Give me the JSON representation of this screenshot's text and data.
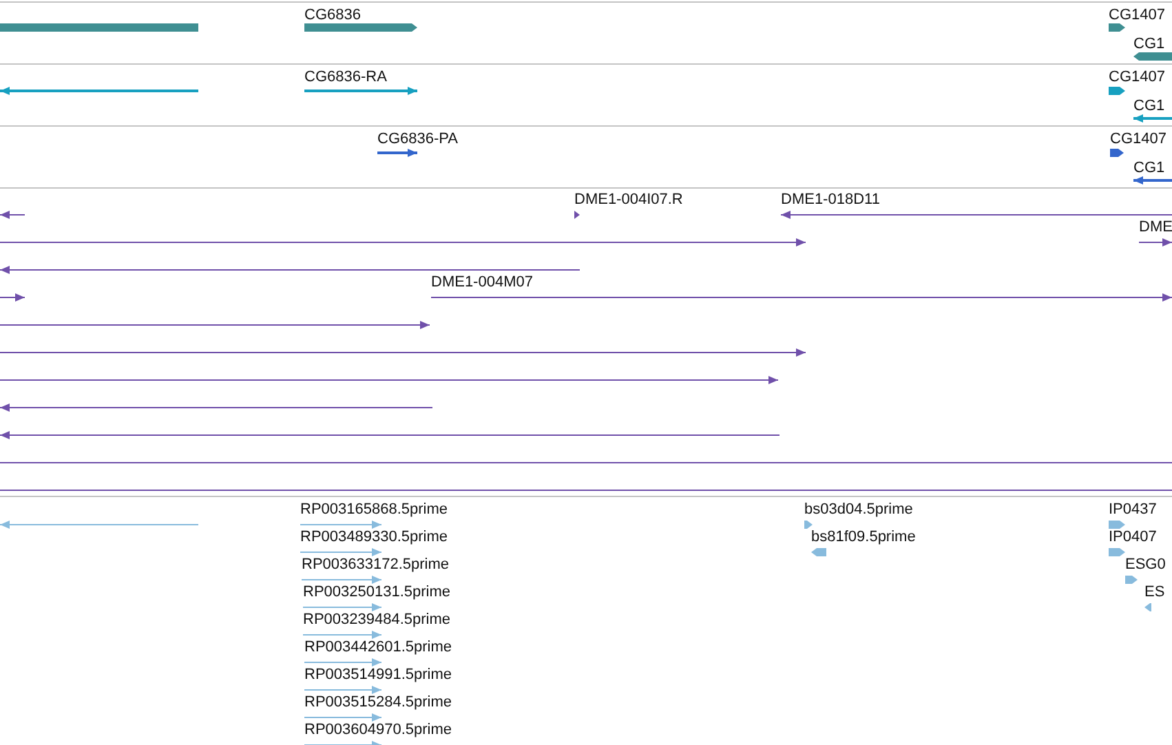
{
  "tracks": [
    {
      "kind": "gene",
      "color": "#3f8f92",
      "features": [
        {
          "kind": "plain"
        },
        {
          "label": "CG6836",
          "kind": "forward"
        },
        {
          "label": "CG1407",
          "kind": "forward"
        },
        {
          "label": "CG1",
          "kind": "reverse"
        }
      ]
    },
    {
      "kind": "transcript",
      "color": "#17a0c0",
      "features": [
        {
          "kind": "reverse"
        },
        {
          "label": "CG6836-RA",
          "kind": "forward"
        },
        {
          "label": "CG1407",
          "kind": "forward"
        },
        {
          "label": "CG1",
          "kind": "reverse"
        }
      ]
    },
    {
      "kind": "protein",
      "color": "#3366cc",
      "features": [
        {
          "label": "CG6836-PA",
          "kind": "forward"
        },
        {
          "label": "CG1407",
          "kind": "forward"
        },
        {
          "label": "CG1",
          "kind": "reverse"
        }
      ]
    },
    {
      "kind": "clone",
      "color": "#7050aa",
      "features": [
        {
          "kind": "reverse"
        },
        {
          "label": "DME1-004I07.R",
          "kind": "forward"
        },
        {
          "label": "DME1-018D11",
          "kind": "reverse"
        },
        {
          "kind": "forward"
        },
        {
          "label": "DME",
          "kind": "forward"
        },
        {
          "kind": "reverse"
        },
        {
          "kind": "forward"
        },
        {
          "label": "DME1-004M07",
          "kind": "forward"
        },
        {
          "kind": "forward"
        },
        {
          "kind": "forward"
        },
        {
          "kind": "forward"
        },
        {
          "kind": "reverse"
        },
        {
          "kind": "reverse"
        },
        {
          "kind": "plain"
        },
        {
          "kind": "plain"
        }
      ]
    },
    {
      "kind": "est",
      "color": "#88bbdd",
      "features": [
        {
          "kind": "reverse"
        },
        {
          "label": "RP003165868.5prime",
          "kind": "forward"
        },
        {
          "label": "RP003489330.5prime",
          "kind": "forward"
        },
        {
          "label": "RP003633172.5prime",
          "kind": "forward"
        },
        {
          "label": "RP003250131.5prime",
          "kind": "forward"
        },
        {
          "label": "RP003239484.5prime",
          "kind": "forward"
        },
        {
          "label": "RP003442601.5prime",
          "kind": "forward"
        },
        {
          "label": "RP003514991.5prime",
          "kind": "forward"
        },
        {
          "label": "RP003515284.5prime",
          "kind": "forward"
        },
        {
          "label": "RP003604970.5prime",
          "kind": "forward"
        },
        {
          "label": "bs03d04.5prime",
          "kind": "forward"
        },
        {
          "label": "bs81f09.5prime",
          "kind": "reverse"
        },
        {
          "label": "IP0437",
          "kind": "forward"
        },
        {
          "label": "IP0407",
          "kind": "forward"
        },
        {
          "label": "ESG0",
          "kind": "forward"
        },
        {
          "label": "ES",
          "kind": "reverse"
        }
      ]
    }
  ]
}
